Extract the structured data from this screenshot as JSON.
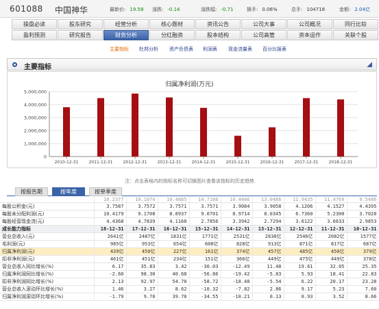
{
  "quote": {
    "code": "601088",
    "name": "中国神华",
    "price_label": "最新价:",
    "price": "19.58",
    "change_label": "涨跌:",
    "change": "-0.14",
    "pct_label": "涨跌幅:",
    "pct": "-0.71",
    "turnover_label": "换手:",
    "turnover": "0.06%",
    "volume_label": "总手:",
    "volume": "104718",
    "amount_label": "金额:",
    "amount": "2.04亿"
  },
  "nav": {
    "row1": [
      "操盘必读",
      "股东研究",
      "经营分析",
      "核心题材",
      "资讯公告",
      "公司大事",
      "公司概况",
      "同行比较"
    ],
    "row2": [
      "盈利预测",
      "研究报告",
      "财务分析",
      "分红融资",
      "股本结构",
      "公司高管",
      "资本运作",
      "关联个股"
    ],
    "active": "财务分析"
  },
  "subtabs": [
    "主要指标",
    "杜邦分析",
    "资产负债表",
    "利润表",
    "现金流量表",
    "百分比报表"
  ],
  "section_title": "主要指标",
  "chart_data": {
    "type": "bar",
    "title": "归属净利润(万元)",
    "categories": [
      "2010-12-31",
      "2011-12-31",
      "2012-12-31",
      "2013-12-31",
      "2014-12-31",
      "2015-12-31",
      "2016-12-31",
      "2017-12-31",
      "2018-12-31"
    ],
    "values": [
      3800000,
      4500000,
      4850000,
      4550000,
      3750000,
      1600000,
      2250000,
      4500000,
      4400000
    ],
    "ylim": [
      0,
      5000000
    ],
    "yticks": [
      "0",
      "1,000,000",
      "2,000,000",
      "3,000,000",
      "4,000,000",
      "5,000,000"
    ],
    "bar_color": "#a50e12",
    "grid": true
  },
  "note": "注：点击表格内的指标名称可切换图片查看该指标的历史趋势",
  "period_tabs": [
    "按报告期",
    "按年度",
    "按单季度"
  ],
  "active_period": "按年度",
  "table": {
    "cut_row": [
      "",
      "10.2377",
      "10.1074",
      "10.4885",
      "14.7166",
      "10.4406",
      "13.0486",
      "11.9435",
      "11.4769",
      "9.5486"
    ],
    "pre_rows": [
      [
        "每股公积金(元)",
        "3.7587",
        "3.7572",
        "3.7571",
        "3.7571",
        "3.9084",
        "3.9058",
        "4.1206",
        "4.1527",
        "4.4395"
      ],
      [
        "每股未分配利润(元)",
        "10.4179",
        "9.1708",
        "8.8937",
        "9.0701",
        "8.9714",
        "8.0345",
        "6.7360",
        "5.2300",
        "3.7020"
      ],
      [
        "每股经营现金流(元)",
        "4.4368",
        "4.7839",
        "4.1168",
        "2.7856",
        "3.3942",
        "2.7294",
        "3.6122",
        "3.6633",
        "2.9853"
      ]
    ],
    "header": [
      "成长能力指标",
      "18-12-31",
      "17-12-31",
      "16-12-31",
      "15-12-31",
      "14-12-31",
      "13-12-31",
      "12-12-31",
      "11-12-31",
      "10-12-31"
    ],
    "rows": [
      [
        "营业总收入(元)",
        "2641亿",
        "2487亿",
        "1831亿",
        "1771亿",
        "2531亿",
        "2838亿",
        "2546亿",
        "2082亿",
        "1577亿"
      ],
      [
        "毛利润(元)",
        "985亿",
        "953亿",
        "654亿",
        "608亿",
        "828亿",
        "913亿",
        "871亿",
        "817亿",
        "687亿"
      ],
      [
        "归属净利润(元)",
        "439亿",
        "450亿",
        "227亿",
        "161亿",
        "374亿",
        "457亿",
        "485亿",
        "450亿",
        "379亿"
      ],
      [
        "扣非净利润(元)",
        "461亿",
        "451亿",
        "234亿",
        "151亿",
        "366亿",
        "449亿",
        "475亿",
        "449亿",
        "378亿"
      ],
      [
        "营业总收入同比增长(%)",
        "6.17",
        "35.83",
        "3.42",
        "-30.03",
        "-12.49",
        "11.48",
        "19.61",
        "32.05",
        "25.35"
      ],
      [
        "归属净利润同比增长(%)",
        "-2.60",
        "98.30",
        "40.68",
        "-56.86",
        "-19.42",
        "-5.83",
        "5.93",
        "18.41",
        "22.83"
      ],
      [
        "扣非净利润同比增长(%)",
        "2.13",
        "92.97",
        "54.70",
        "-58.72",
        "-18.48",
        "-5.54",
        "6.22",
        "20.17",
        "23.28"
      ],
      [
        "营业总收入滚动环比增长(%)",
        "1.46",
        "3.27",
        "8.62",
        "-10.32",
        "-7.82",
        "2.86",
        "9.17",
        "5.23",
        "7.60"
      ],
      [
        "归属净利润滚动环比增长(%)",
        "-1.79",
        "9.70",
        "39.70",
        "-34.55",
        "-10.21",
        "0.13",
        "0.93",
        "3.52",
        "8.66"
      ]
    ],
    "highlight_row": "归属净利润(元)"
  }
}
